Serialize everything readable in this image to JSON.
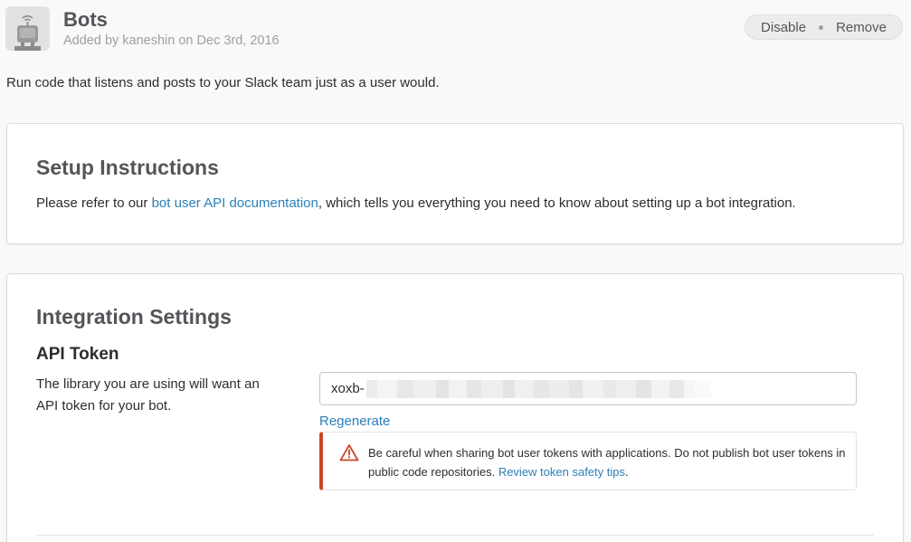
{
  "header": {
    "app_icon": "robot-icon",
    "title": "Bots",
    "subtitle": "Added by kaneshin on Dec 3rd, 2016",
    "actions": {
      "disable_label": "Disable",
      "remove_label": "Remove"
    }
  },
  "description": "Run code that listens and posts to your Slack team just as a user would.",
  "setup": {
    "title": "Setup Instructions",
    "text_before": "Please refer to our ",
    "link_text": "bot user API documentation",
    "text_after": ", which tells you everything you need to know about setting up a bot integration."
  },
  "settings": {
    "title": "Integration Settings",
    "api_token": {
      "title": "API Token",
      "description": "The library you are using will want an API token for your bot.",
      "value_prefix": "xoxb-",
      "value_obscured": true,
      "regenerate_label": "Regenerate"
    },
    "warning": {
      "icon": "warning-triangle-icon",
      "text": "Be careful when sharing bot user tokens with applications. Do not publish bot user tokens in public code repositories. ",
      "link_text": "Review token safety tips",
      "text_end": ".",
      "accent_color": "#c9472a"
    }
  },
  "colors": {
    "link": "#2a80b9",
    "background": "#f9f9f9",
    "card": "#ffffff"
  }
}
